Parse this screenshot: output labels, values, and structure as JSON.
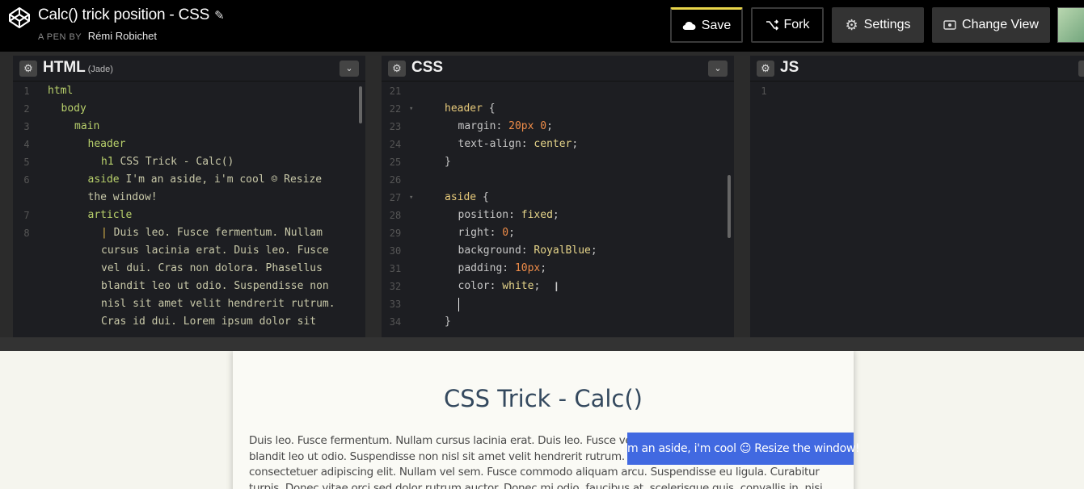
{
  "header": {
    "pen_title": "Calc() trick position - CSS",
    "by_label": "A PEN BY",
    "author": "Rémi Robichet",
    "buttons": {
      "save": "Save",
      "fork": "Fork",
      "settings": "Settings",
      "change_view": "Change View"
    }
  },
  "editors": {
    "html": {
      "title": "HTML",
      "preprocessor": "(Jade)",
      "lines": [
        {
          "n": "1",
          "indent": 0,
          "parts": [
            [
              "tag",
              "html"
            ]
          ]
        },
        {
          "n": "2",
          "indent": 1,
          "parts": [
            [
              "tag",
              "body"
            ]
          ]
        },
        {
          "n": "3",
          "indent": 2,
          "parts": [
            [
              "tag",
              "main"
            ]
          ]
        },
        {
          "n": "4",
          "indent": 3,
          "parts": [
            [
              "tag",
              "header"
            ]
          ]
        },
        {
          "n": "5",
          "indent": 4,
          "parts": [
            [
              "tag",
              "h1"
            ],
            [
              "txt",
              " CSS Trick - Calc()"
            ]
          ]
        },
        {
          "n": "6",
          "indent": 3,
          "parts": [
            [
              "tag",
              "aside"
            ],
            [
              "txt",
              " I'm an aside, i'm cool ☺ Resize"
            ]
          ]
        },
        {
          "n": "",
          "indent": 3,
          "parts": [
            [
              "txt",
              "the window!"
            ]
          ]
        },
        {
          "n": "7",
          "indent": 3,
          "parts": [
            [
              "tag",
              "article"
            ]
          ]
        },
        {
          "n": "8",
          "indent": 4,
          "parts": [
            [
              "pipe",
              "|"
            ],
            [
              "txt",
              " Duis leo. Fusce fermentum. Nullam"
            ]
          ]
        },
        {
          "n": "",
          "indent": 4,
          "parts": [
            [
              "txt",
              "cursus lacinia erat. Duis leo. Fusce"
            ]
          ]
        },
        {
          "n": "",
          "indent": 4,
          "parts": [
            [
              "txt",
              "vel dui. Cras non dolora. Phasellus"
            ]
          ]
        },
        {
          "n": "",
          "indent": 4,
          "parts": [
            [
              "txt",
              "blandit leo ut odio. Suspendisse non"
            ]
          ]
        },
        {
          "n": "",
          "indent": 4,
          "parts": [
            [
              "txt",
              "nisl sit amet velit hendrerit rutrum."
            ]
          ]
        },
        {
          "n": "",
          "indent": 4,
          "parts": [
            [
              "txt",
              "Cras id dui. Lorem ipsum dolor sit"
            ]
          ]
        }
      ]
    },
    "css": {
      "title": "CSS",
      "lines": [
        {
          "n": "21",
          "fold": false,
          "indent": 0,
          "parts": []
        },
        {
          "n": "22",
          "fold": true,
          "indent": 0,
          "parts": [
            [
              "sel",
              "header"
            ],
            [
              "prop",
              " {"
            ]
          ]
        },
        {
          "n": "23",
          "fold": false,
          "indent": 1,
          "parts": [
            [
              "prop",
              "margin: "
            ],
            [
              "num",
              "20px 0"
            ],
            [
              "prop",
              ";"
            ]
          ]
        },
        {
          "n": "24",
          "fold": false,
          "indent": 1,
          "parts": [
            [
              "prop",
              "text-align: "
            ],
            [
              "kw",
              "center"
            ],
            [
              "prop",
              ";"
            ]
          ]
        },
        {
          "n": "25",
          "fold": false,
          "indent": 0,
          "parts": [
            [
              "prop",
              "}"
            ]
          ]
        },
        {
          "n": "26",
          "fold": false,
          "indent": 0,
          "parts": []
        },
        {
          "n": "27",
          "fold": true,
          "indent": 0,
          "parts": [
            [
              "sel",
              "aside"
            ],
            [
              "prop",
              " {"
            ]
          ]
        },
        {
          "n": "28",
          "fold": false,
          "indent": 1,
          "parts": [
            [
              "prop",
              "position: "
            ],
            [
              "kw",
              "fixed"
            ],
            [
              "prop",
              ";"
            ]
          ]
        },
        {
          "n": "29",
          "fold": false,
          "indent": 1,
          "parts": [
            [
              "prop",
              "right: "
            ],
            [
              "num",
              "0"
            ],
            [
              "prop",
              ";"
            ]
          ]
        },
        {
          "n": "30",
          "fold": false,
          "indent": 1,
          "parts": [
            [
              "prop",
              "background: "
            ],
            [
              "kw",
              "RoyalBlue"
            ],
            [
              "prop",
              ";"
            ]
          ]
        },
        {
          "n": "31",
          "fold": false,
          "indent": 1,
          "parts": [
            [
              "prop",
              "padding: "
            ],
            [
              "num",
              "10px"
            ],
            [
              "prop",
              ";"
            ]
          ]
        },
        {
          "n": "32",
          "fold": false,
          "indent": 1,
          "parts": [
            [
              "prop",
              "color: "
            ],
            [
              "kw",
              "white"
            ],
            [
              "prop",
              ";"
            ]
          ]
        },
        {
          "n": "33",
          "fold": false,
          "indent": 1,
          "parts": [
            [
              "cursor",
              ""
            ]
          ]
        },
        {
          "n": "34",
          "fold": false,
          "indent": 0,
          "parts": [
            [
              "prop",
              "}"
            ]
          ]
        }
      ]
    },
    "js": {
      "title": "JS",
      "lines": [
        {
          "n": "1"
        }
      ]
    }
  },
  "preview": {
    "title": "CSS Trick - Calc()",
    "aside_text": "I'm an aside, i'm cool ☺ Resize the window!",
    "article_text": "Duis leo. Fusce fermentum. Nullam cursus lacinia erat. Duis leo. Fusce vel dui. Cras non dolora. Phasellus blandit leo ut odio. Suspendisse non nisl sit amet velit hendrerit rutrum. Cras id dui. Lorem ipsum dolor sit amet, consectetuer adipiscing elit. Nullam vel sem. Fusce commodo aliquam arcu. Suspendisse eu ligula. Curabitur turpis. Donec vitae orci sed dolor rutrum auctor. Donec mi odio, faucibus at, scelerisque quis, convallis in, nisi."
  },
  "colors": {
    "accent_save": "#e9d54a",
    "aside_bg": "#4169e1",
    "preview_title": "#34495e"
  },
  "icons": [
    "codepen-logo-icon",
    "pencil-icon",
    "cloud-icon",
    "fork-icon",
    "gear-icon",
    "eye-icon",
    "chevron-down-icon"
  ]
}
